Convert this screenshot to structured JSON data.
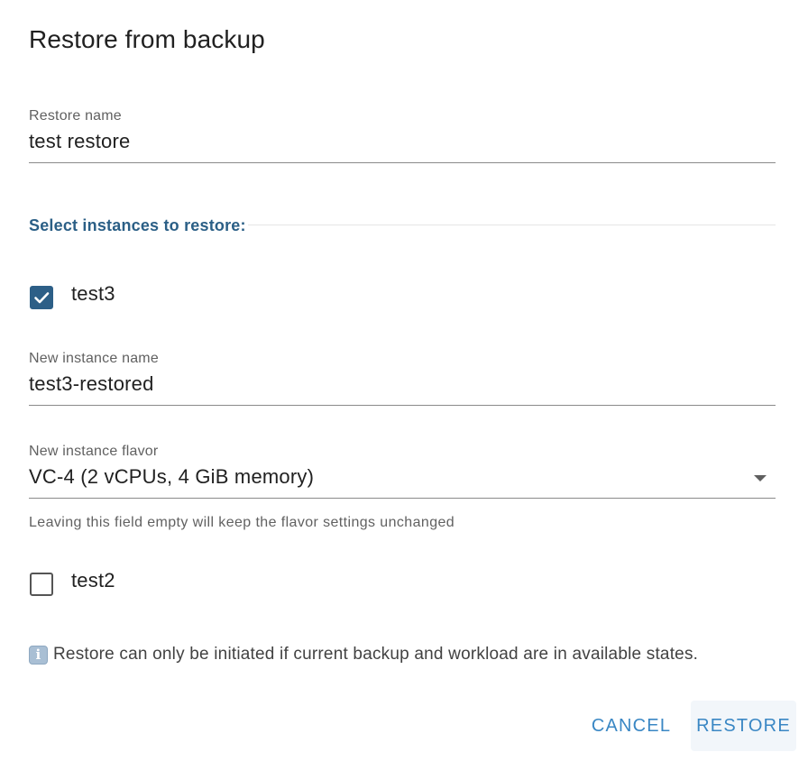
{
  "dialog": {
    "title": "Restore from backup"
  },
  "restore_name": {
    "label": "Restore name",
    "value": "test restore"
  },
  "instances_section": {
    "title": "Select instances to restore:"
  },
  "instances": [
    {
      "name": "test3",
      "checked": true,
      "new_name": {
        "label": "New instance name",
        "value": "test3-restored"
      },
      "flavor": {
        "label": "New instance flavor",
        "value": "VC-4 (2 vCPUs, 4 GiB memory)",
        "hint": "Leaving this field empty will keep the flavor settings unchanged"
      }
    },
    {
      "name": "test2",
      "checked": false
    }
  ],
  "info": {
    "icon": "info-icon",
    "glyph": "i",
    "text": "Restore can only be initiated if current backup and workload are in available states."
  },
  "actions": {
    "cancel_label": "CANCEL",
    "restore_label": "RESTORE"
  },
  "colors": {
    "accent": "#2d5f87",
    "button_text": "#3a87c4",
    "section_title": "#2b5f86"
  }
}
